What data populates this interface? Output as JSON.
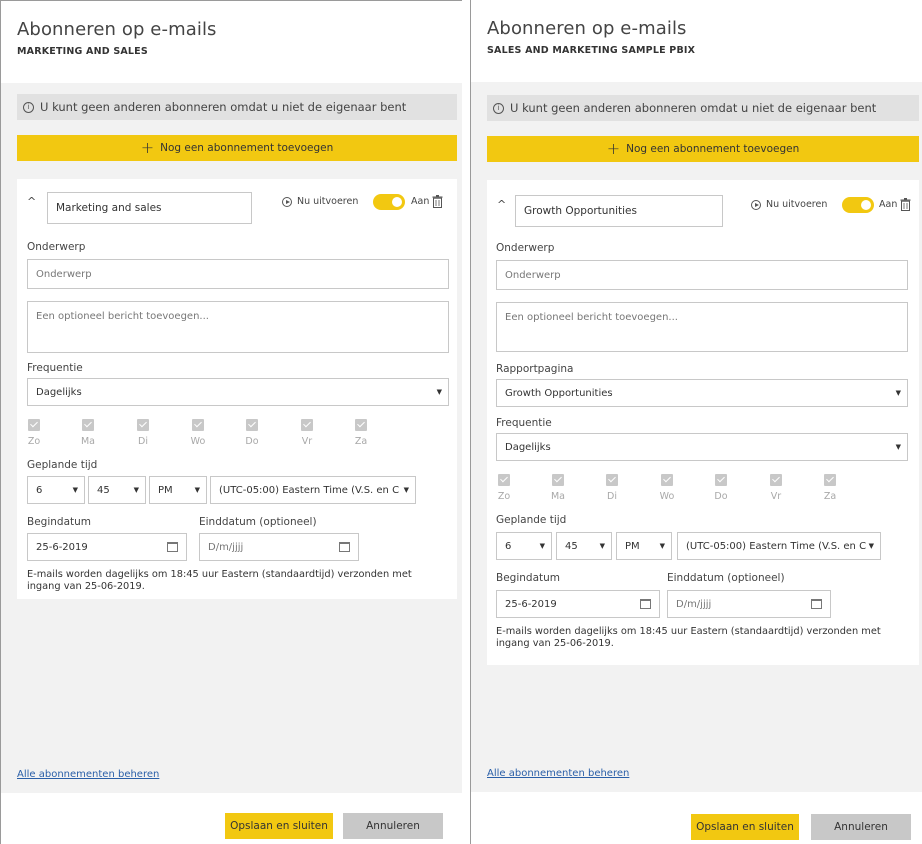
{
  "left": {
    "title": "Abonneren op e-mails",
    "subtitle": "MARKETING AND SALES",
    "notice": "U kunt geen anderen abonneren omdat u niet de eigenaar bent",
    "add_label": "Nog een abonnement toevoegen",
    "subscription_name": "Marketing and sales",
    "run_now": "Nu uitvoeren",
    "toggle_label": "Aan",
    "subject_label": "Onderwerp",
    "subject_placeholder": "Onderwerp",
    "message_placeholder": "Een optioneel bericht toevoegen...",
    "frequency_label": "Frequentie",
    "frequency_value": "Dagelijks",
    "days": [
      "Zo",
      "Ma",
      "Di",
      "Wo",
      "Do",
      "Vr",
      "Za"
    ],
    "time_label": "Geplande tijd",
    "hour": "6",
    "minute": "45",
    "ampm": "PM",
    "timezone": "(UTC-05:00) Eastern Time (V.S. en C",
    "start_label": "Begindatum",
    "start_value": "25-6-2019",
    "end_label": "Einddatum (optioneel)",
    "end_placeholder": "D/m/jjjj",
    "note": "E-mails worden dagelijks om 18:45 uur Eastern (standaardtijd) verzonden met ingang van 25-06-2019.",
    "manage_link": "Alle abonnementen beheren",
    "save_label": "Opslaan en sluiten",
    "cancel_label": "Annuleren"
  },
  "right": {
    "title": "Abonneren op e-mails",
    "subtitle": "SALES AND MARKETING SAMPLE PBIX",
    "notice": "U kunt geen anderen abonneren omdat u niet de eigenaar bent",
    "add_label": "Nog een abonnement toevoegen",
    "subscription_name": "Growth Opportunities",
    "run_now": "Nu uitvoeren",
    "toggle_label": "Aan",
    "subject_label": "Onderwerp",
    "subject_placeholder": "Onderwerp",
    "message_placeholder": "Een optioneel bericht toevoegen...",
    "report_page_label": "Rapportpagina",
    "report_page_value": "Growth Opportunities",
    "frequency_label": "Frequentie",
    "frequency_value": "Dagelijks",
    "days": [
      "Zo",
      "Ma",
      "Di",
      "Wo",
      "Do",
      "Vr",
      "Za"
    ],
    "time_label": "Geplande tijd",
    "hour": "6",
    "minute": "45",
    "ampm": "PM",
    "timezone": "(UTC-05:00) Eastern Time (V.S. en C",
    "start_label": "Begindatum",
    "start_value": "25-6-2019",
    "end_label": "Einddatum (optioneel)",
    "end_placeholder": "D/m/jjjj",
    "note": "E-mails worden dagelijks om 18:45 uur Eastern (standaardtijd) verzonden met ingang van 25-06-2019.",
    "manage_link": "Alle abonnementen beheren",
    "save_label": "Opslaan en sluiten",
    "cancel_label": "Annuleren"
  }
}
